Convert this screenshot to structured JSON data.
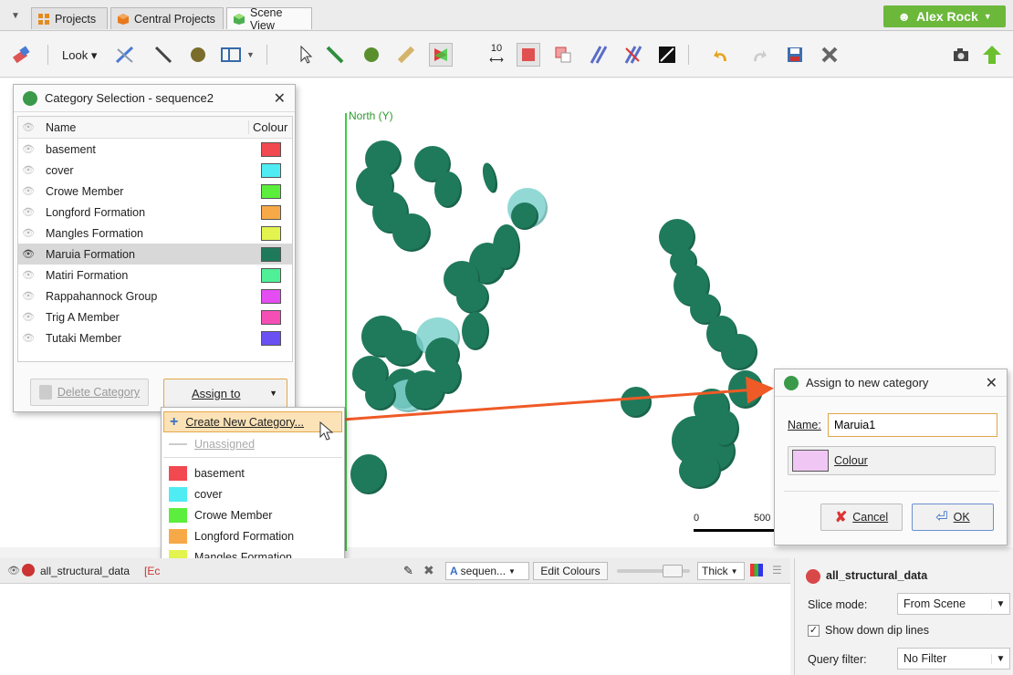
{
  "tabs": [
    {
      "label": "Projects"
    },
    {
      "label": "Central Projects"
    },
    {
      "label": "Scene View"
    }
  ],
  "user": {
    "name": "Alex Rock"
  },
  "toolbar": {
    "look_label": "Look",
    "scale_label": "10"
  },
  "scene": {
    "north_label": "North (Y)",
    "scale_start": "0",
    "scale_end": "500"
  },
  "category_dialog": {
    "title": "Category Selection - sequence2",
    "col_name": "Name",
    "col_colour": "Colour",
    "categories": [
      {
        "name": "basement",
        "colour": "#f2484f"
      },
      {
        "name": "cover",
        "colour": "#4fecf4"
      },
      {
        "name": "Crowe Member",
        "colour": "#5cee3c"
      },
      {
        "name": "Longford Formation",
        "colour": "#f7a947"
      },
      {
        "name": "Mangles Formation",
        "colour": "#e2f44d"
      },
      {
        "name": "Maruia Formation",
        "colour": "#1f7a5c"
      },
      {
        "name": "Matiri Formation",
        "colour": "#4ff097"
      },
      {
        "name": "Rappahannock Group",
        "colour": "#e34df2"
      },
      {
        "name": "Trig A Member",
        "colour": "#f54fb6"
      },
      {
        "name": "Tutaki Member",
        "colour": "#6a4ff2"
      }
    ],
    "selected": "Maruia Formation",
    "delete_label": "Delete Category",
    "assign_label": "Assign to"
  },
  "menu": {
    "create_label": "Create New Category...",
    "unassigned_label": "Unassigned"
  },
  "bottom": {
    "layer_name": "all_structural_data",
    "edit_tag": "[Ec",
    "sequence_label": "sequen...",
    "edit_colours_label": "Edit Colours",
    "thickness_label": "Thick"
  },
  "props": {
    "title": "all_structural_data",
    "slice_mode_label": "Slice mode:",
    "slice_mode_value": "From Scene",
    "show_dip_label": "Show down dip lines",
    "show_dip_checked": true,
    "query_filter_label": "Query filter:",
    "query_filter_value": "No Filter"
  },
  "new_dialog": {
    "title": "Assign to new category",
    "name_label": "Name:",
    "name_value": "Maruia1",
    "colour_label": "Colour",
    "colour_swatch": "#f0c6f4",
    "cancel_label": "Cancel",
    "ok_label": "OK"
  }
}
